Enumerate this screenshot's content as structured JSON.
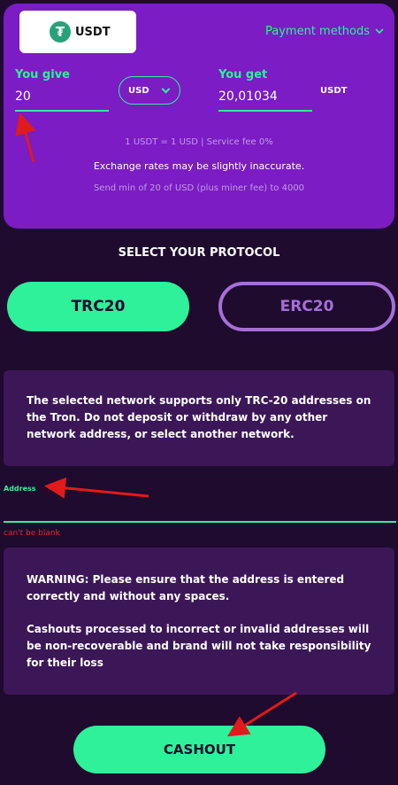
{
  "coin": {
    "label": "USDT",
    "icon": "tether-icon",
    "icon_glyph": "₮"
  },
  "payment_methods": {
    "label": "Payment methods",
    "icon": "chevron-down-icon"
  },
  "exchange": {
    "give_label": "You give",
    "give_value": "20",
    "currency": "USD",
    "get_label": "You get",
    "get_value": "20,01034",
    "get_currency": "USDT",
    "rate_text": "1 USDT = 1 USD | Service fee 0%",
    "accuracy_note": "Exchange rates may be slightly inaccurate.",
    "limits_text": "Send min of 20 of USD (plus miner fee) to 4000"
  },
  "protocol": {
    "title": "SELECT YOUR PROTOCOL",
    "options": [
      {
        "label": "TRC20",
        "selected": true
      },
      {
        "label": "ERC20",
        "selected": false
      }
    ]
  },
  "network_info": {
    "text": "The selected network supports only TRC-20 addresses on the Tron. Do not deposit or withdraw by any other network address, or select another network."
  },
  "address": {
    "label": "Address",
    "value": "",
    "error": "can't be blank"
  },
  "warning": {
    "paragraph1": "WARNING: Please ensure that the address is entered correctly and without any spaces.",
    "paragraph2": "Cashouts processed to incorrect or invalid addresses will be non-recoverable and brand will not take responsibility for their loss"
  },
  "cashout": {
    "label": "CASHOUT"
  },
  "colors": {
    "background": "#1e0b2e",
    "card": "#7b1cc4",
    "accent": "#2ef19a",
    "inactive": "#a66fd8",
    "error": "#e02a2a",
    "annotation": "#e01b1b"
  }
}
